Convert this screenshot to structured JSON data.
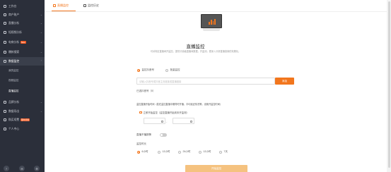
{
  "sidebar": {
    "items": [
      {
        "label": "工作台",
        "icon": "home-icon",
        "has_chevron": false
      },
      {
        "label": "商户账户",
        "icon": "wallet-icon",
        "has_chevron": true
      },
      {
        "label": "直播分析",
        "icon": "live-icon",
        "has_chevron": true
      },
      {
        "label": "短视频分析",
        "icon": "video-icon",
        "has_chevron": true
      },
      {
        "label": "电商分析",
        "icon": "cart-icon",
        "has_chevron": true,
        "badge": "New"
      },
      {
        "label": "爆款搜索",
        "icon": "search-icon",
        "has_chevron": true
      },
      {
        "label": "数据监控",
        "icon": "monitor-icon",
        "has_chevron": true,
        "active": true
      },
      {
        "label": "品牌分析",
        "icon": "brand-icon",
        "has_chevron": true
      },
      {
        "label": "数据导出",
        "icon": "export-icon",
        "has_chevron": true
      },
      {
        "label": "购买续费",
        "icon": "purchase-icon",
        "has_chevron": false,
        "badge": "限时优惠"
      },
      {
        "label": "个人中心",
        "icon": "user-icon",
        "has_chevron": false
      }
    ],
    "submenu": [
      "我的监控",
      "视频监控",
      "直播监控"
    ],
    "bottom_icons": [
      "help-icon",
      "message-icon",
      "settings-icon"
    ]
  },
  "tabs": [
    {
      "label": "直播监控",
      "active": true
    },
    {
      "label": "监控历史",
      "active": false
    }
  ],
  "hero": {
    "title": "直播监控",
    "subtitle": "可对特定直播间开监控，提供分钟级直播间数据，开监测，更深入分析直播营销的效果化。"
  },
  "form": {
    "mode_options": [
      "监控抖音号",
      "批量监控"
    ],
    "search_placeholder": "请输入抖音号或抖音主页链接或直播链接",
    "search_button": "添加",
    "selected_account_label": "已选抖音号（0）",
    "time_section_label": "监控直播开始时间（若在监控直播中期同时开播，平均延迟情况等，设置开监控时间）",
    "checkbox_label": "立即开始监控（监控直播开始到未开监测）",
    "range_dash": "-",
    "auto_stop_label": "直播不播报警",
    "duration_label": "监控时长",
    "duration_options": [
      "6小时",
      "12小时",
      "24小时",
      "12小时",
      "7天"
    ],
    "submit_label": "开始监控"
  },
  "colors": {
    "accent": "#f2761d",
    "sidebar_bg": "#2b2f3a"
  }
}
